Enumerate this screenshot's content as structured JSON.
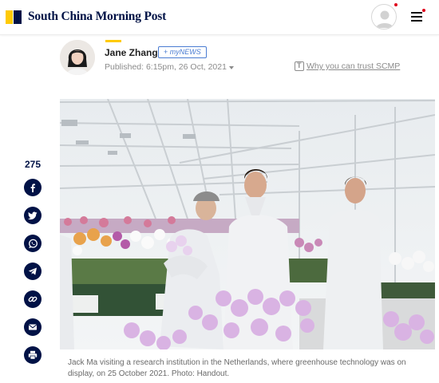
{
  "header": {
    "logo_text": "South China Morning Post",
    "brand_colors": {
      "navy": "#001246",
      "yellow": "#ffca05"
    },
    "icons": [
      "logo-mark",
      "user-avatar-icon",
      "notification-dot",
      "hamburger-menu-icon"
    ]
  },
  "byline": {
    "author_name": "Jane Zhang",
    "follow_prefix": "+ ",
    "follow_brand": "myNEWS",
    "published": "Published: 6:15pm, 26 Oct, 2021",
    "trust_link": "Why you can trust SCMP"
  },
  "share": {
    "count": "275",
    "buttons": [
      "facebook-icon",
      "twitter-icon",
      "whatsapp-icon",
      "telegram-icon",
      "link-icon",
      "email-icon",
      "print-icon"
    ]
  },
  "image": {
    "caption": "Jack Ma visiting a research institution in the Netherlands, where greenhouse technology was on display, on 25 October 2021. Photo: Handout."
  }
}
